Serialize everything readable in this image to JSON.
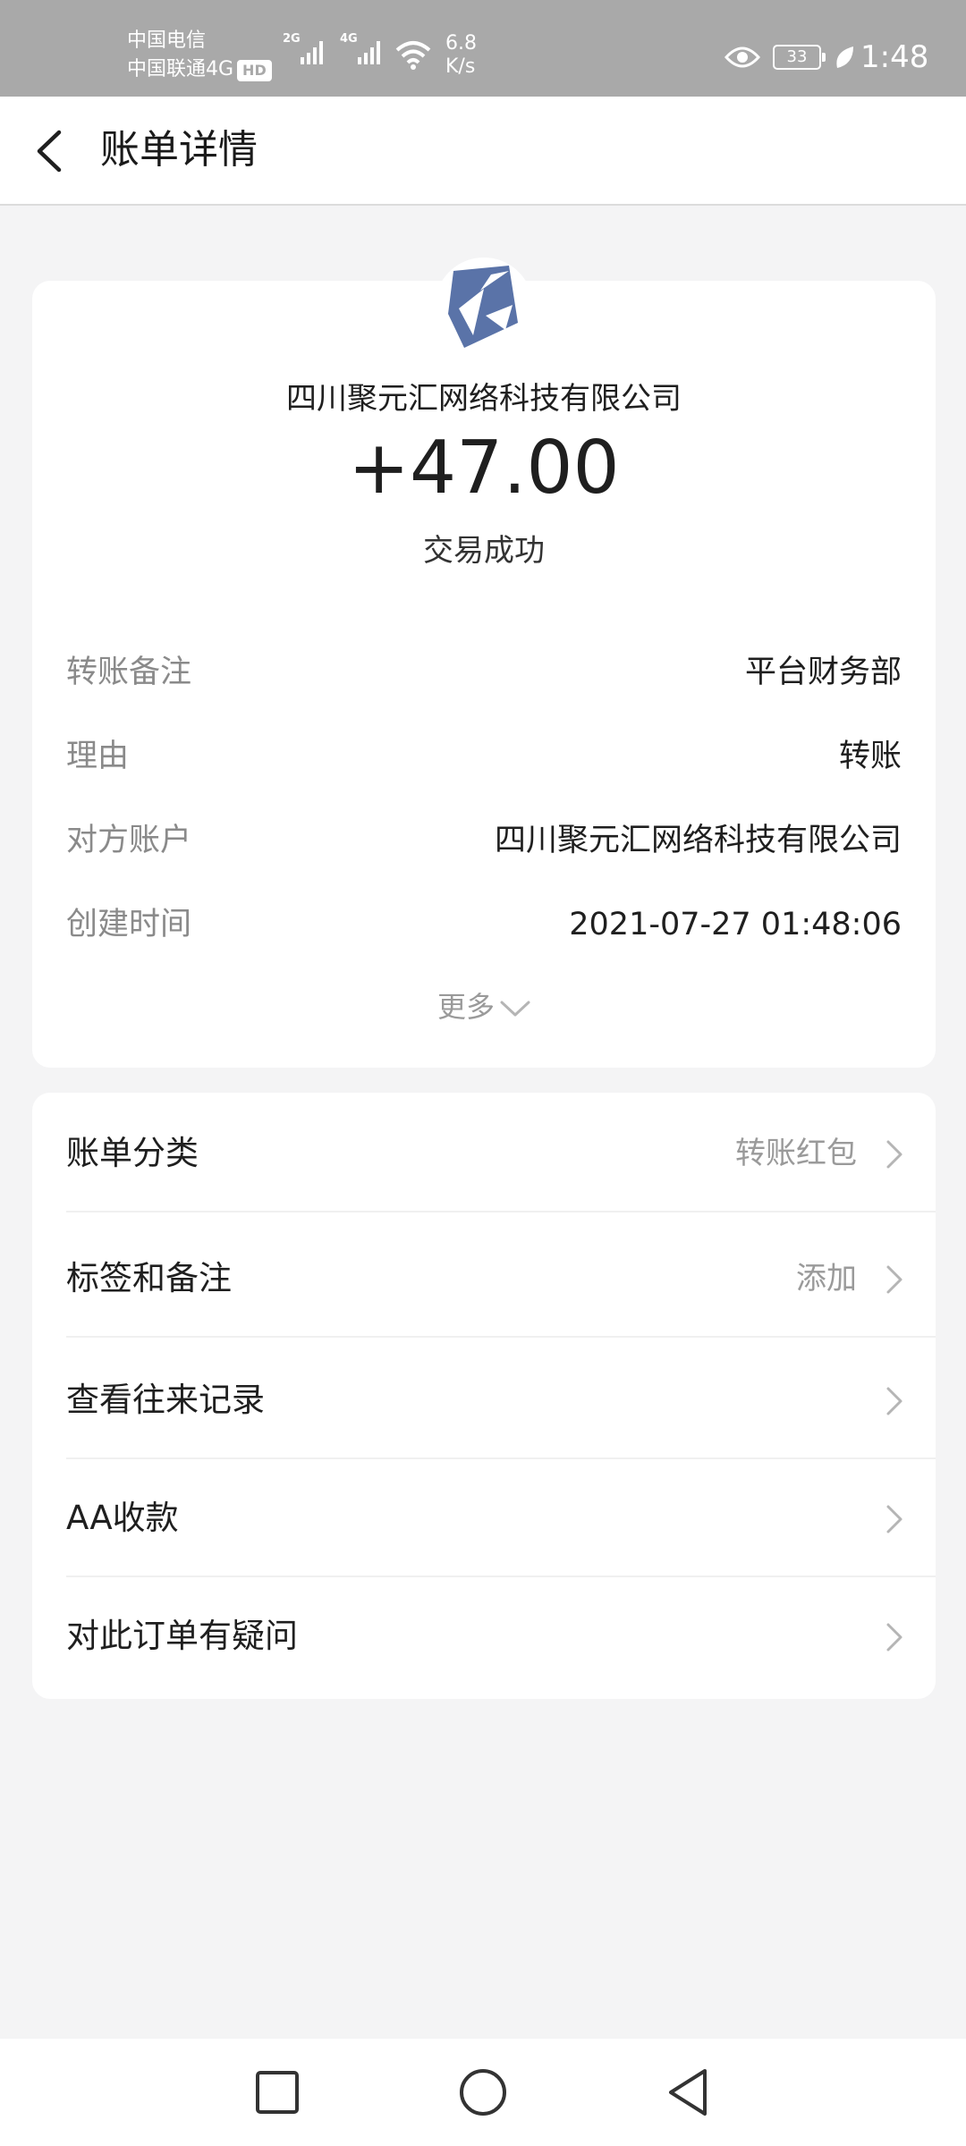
{
  "status_bar": {
    "carrier1": "中国电信",
    "carrier2": "中国联通4G",
    "hd": "HD",
    "sig1_tag": "2G",
    "sig2_tag": "4G",
    "speed_value": "6.8",
    "speed_unit": "K/s",
    "battery": "33",
    "time": "1:48"
  },
  "header": {
    "title": "账单详情"
  },
  "summary": {
    "payee": "四川聚元汇网络科技有限公司",
    "amount": "+47.00",
    "status": "交易成功",
    "logo_color": "#5a73a8",
    "details": [
      {
        "label": "转账备注",
        "value": "平台财务部"
      },
      {
        "label": "理由",
        "value": "转账"
      },
      {
        "label": "对方账户",
        "value": "四川聚元汇网络科技有限公司"
      },
      {
        "label": "创建时间",
        "value": "2021-07-27 01:48:06"
      }
    ],
    "more_label": "更多"
  },
  "menu": [
    {
      "label": "账单分类",
      "hint": "转账红包"
    },
    {
      "label": "标签和备注",
      "hint": "添加"
    },
    {
      "label": "查看往来记录",
      "hint": ""
    },
    {
      "label": "AA收款",
      "hint": ""
    },
    {
      "label": "对此订单有疑问",
      "hint": ""
    }
  ],
  "icons": {
    "back": "back-arrow-icon",
    "chevron": "chevron-right-icon",
    "more": "chevron-down-icon",
    "nav": [
      "recent-apps-icon",
      "home-icon",
      "back-triangle-icon"
    ]
  }
}
